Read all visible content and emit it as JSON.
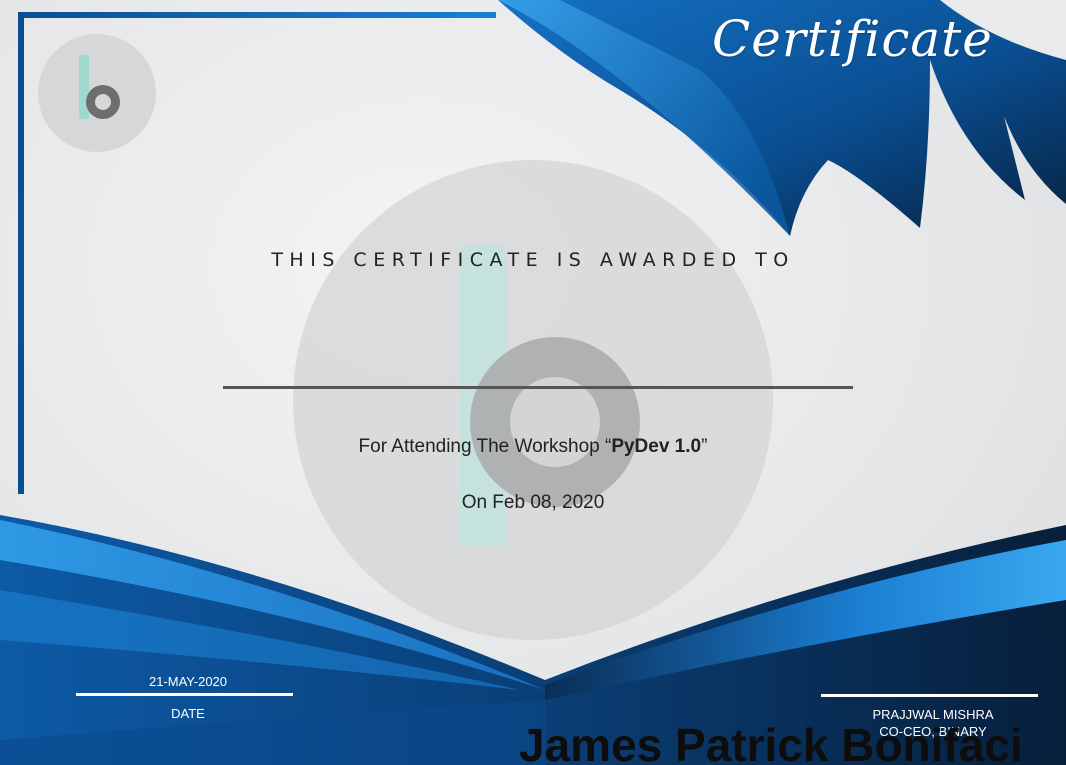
{
  "certificate": {
    "title": "Certificate",
    "awarded_text": "THIS CERTIFICATE IS AWARDED TO",
    "recipient_name": "James Patrick Bonifaci",
    "workshop_prefix": "For Attending The Workshop “",
    "workshop_name": "PyDev 1.0",
    "workshop_suffix": "”",
    "event_date": "On Feb 08, 2020"
  },
  "footer": {
    "issue_date": "21-MAY-2020",
    "date_label": "DATE",
    "signatory_name": "PRAJJWAL MISHRA",
    "signatory_title": "CO-CEO, BINARY"
  },
  "logo": {
    "icon": "binary-b-logo-icon"
  },
  "colors": {
    "primary_blue": "#0a5ea8",
    "dark_navy": "#0b2442",
    "light_blue": "#2f9be8",
    "logo_teal": "#9fd8cc",
    "logo_gray": "#6e6e6e"
  }
}
